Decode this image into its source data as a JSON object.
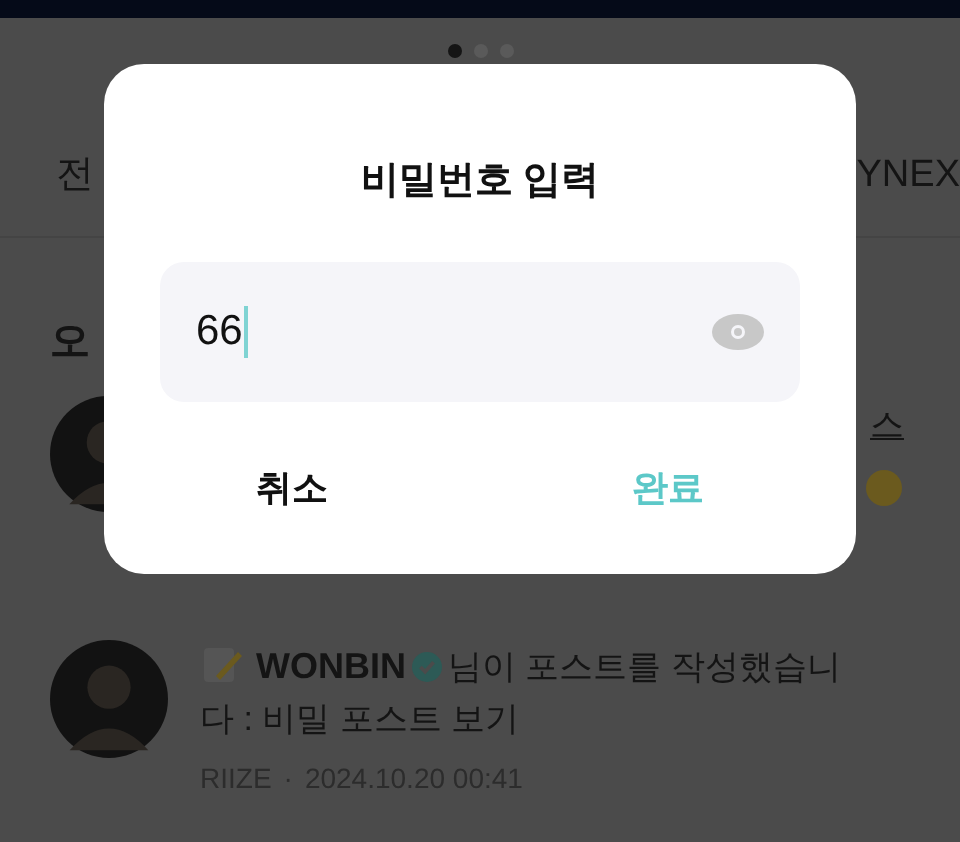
{
  "pager": {
    "dots": [
      {
        "selected": true
      },
      {
        "selected": false
      },
      {
        "selected": false
      }
    ]
  },
  "tabs": [
    {
      "label": "전"
    },
    {
      "label": "YNEX"
    }
  ],
  "section_title": "오",
  "posts": [
    {
      "kind": "partial",
      "text": "스"
    },
    {
      "kind": "full",
      "author": "WONBIN",
      "verified": true,
      "message": "님이 포스트를 작성했습니다 : 비밀 포스트 보기",
      "group": "RIIZE",
      "separator": "·",
      "date": "2024.10.20 00:41"
    }
  ],
  "dialog": {
    "title": "비밀번호 입력",
    "password": {
      "value": "66"
    },
    "buttons": [
      {
        "label": "취소",
        "kind": "cancel"
      },
      {
        "label": "완료",
        "kind": "confirm"
      }
    ]
  }
}
